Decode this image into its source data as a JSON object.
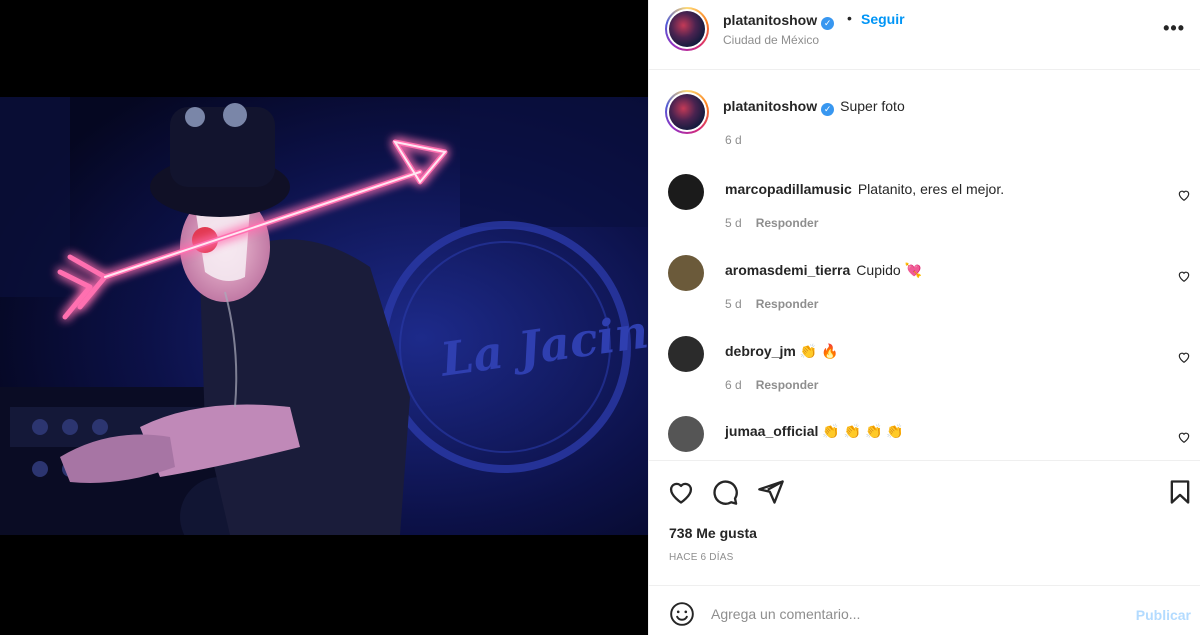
{
  "post": {
    "username": "platanitoshow",
    "follow_label": "Seguir",
    "location": "Ciudad de México",
    "more_glyph": "•••",
    "photo_text": "La Jacinta"
  },
  "caption": {
    "username": "platanitoshow",
    "text": "Super foto",
    "time": "6 d"
  },
  "comments": [
    {
      "username": "marcopadillamusic",
      "text": "Platanito, eres el mejor.",
      "emoji": "",
      "time": "5 d",
      "reply": "Responder",
      "avatar_color": "#1b1b1b"
    },
    {
      "username": "aromasdemi_tierra",
      "text": "Cupido",
      "emoji": "💘",
      "time": "5 d",
      "reply": "Responder",
      "avatar_color": "#6b5a3a"
    },
    {
      "username": "debroy_jm",
      "text": "",
      "emoji": "👏 🔥",
      "time": "6 d",
      "reply": "Responder",
      "avatar_color": "#2b2b2b"
    },
    {
      "username": "jumaa_official",
      "text": "",
      "emoji": "👏 👏 👏 👏",
      "time": "",
      "reply": "",
      "avatar_color": "#555555"
    }
  ],
  "actions": {
    "icons": [
      "heart-icon",
      "comment-icon",
      "share-icon",
      "bookmark-icon"
    ],
    "likes": "738 Me gusta",
    "ago": "HACE 6 DÍAS"
  },
  "add_comment": {
    "placeholder": "Agrega un comentario...",
    "publish_label": "Publicar"
  },
  "colors": {
    "accent": "#0095f6",
    "muted": "#8e8e8e",
    "neon": "#ff5fa8"
  }
}
